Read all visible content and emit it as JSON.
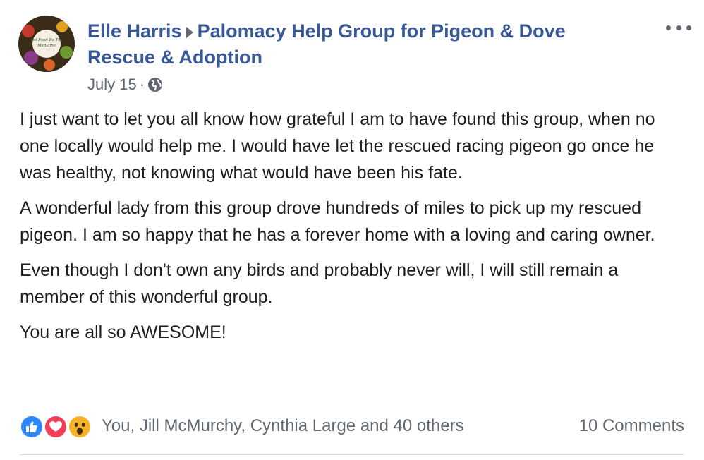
{
  "post": {
    "author": "Elle Harris",
    "group": "Palomacy Help Group for Pigeon & Dove Rescue & Adoption",
    "date": "July 15",
    "date_separator": "·",
    "privacy_icon": "globe-icon",
    "avatar_text": "Let Food Be Thy Medicine",
    "paragraphs": [
      "I just want to let you all know how grateful I am to have found this group, when no one locally would help me. I would have let the rescued racing pigeon go once he was healthy, not knowing what would have been his fate.",
      "A wonderful lady from this group drove hundreds of miles to pick up my rescued pigeon. I am so happy that he has a forever home with a loving and caring owner.",
      "Even though I don't own any birds and probably never will, I will still remain a member of this wonderful group.",
      "You are all so AWESOME!"
    ],
    "reactions": {
      "icons": [
        "like-icon",
        "love-icon",
        "wow-icon"
      ],
      "summary": "You, Jill McMurchy, Cynthia Large and 40 others"
    },
    "comments_label": "10 Comments"
  },
  "colors": {
    "link": "#385898",
    "text": "#1c1e21",
    "muted": "#606770",
    "like": "#2d88ff",
    "love": "#f33e58",
    "wow": "#f7b125"
  }
}
